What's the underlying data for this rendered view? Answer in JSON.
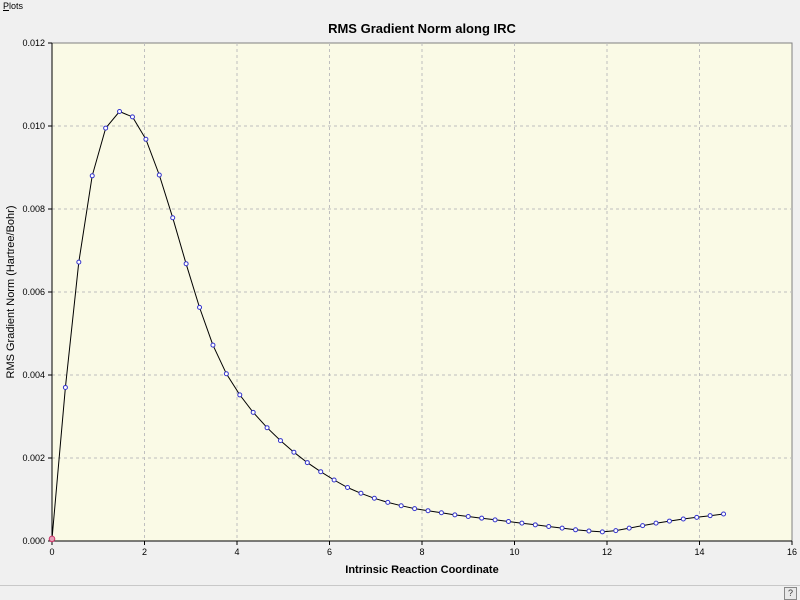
{
  "menu": {
    "plots_underlined": "P",
    "plots_rest": "lots"
  },
  "status": {
    "help_glyph": "?"
  },
  "chart_data": {
    "type": "line",
    "title": "RMS Gradient Norm along IRC",
    "xlabel": "Intrinsic Reaction Coordinate",
    "ylabel": "RMS Gradient Norm (Hartree/Bohr)",
    "xlim": [
      0,
      16
    ],
    "ylim": [
      0,
      0.012
    ],
    "xticks": [
      0,
      2,
      4,
      6,
      8,
      10,
      12,
      14,
      16
    ],
    "xtick_labels": [
      "0",
      "2",
      "4",
      "6",
      "8",
      "10",
      "12",
      "14",
      "16"
    ],
    "yticks": [
      0,
      0.002,
      0.004,
      0.006,
      0.008,
      0.01,
      0.012
    ],
    "ytick_labels": [
      "0.000",
      "0.002",
      "0.004",
      "0.006",
      "0.008",
      "0.010",
      "0.012"
    ],
    "grid": true,
    "colors": {
      "plot_bg": "#fafae6",
      "line": "#000000",
      "marker": "#3333cc",
      "first_marker": "#cc3366",
      "grid": "#bfbfbf"
    },
    "series": [
      {
        "x": [
          0.0,
          0.29,
          0.58,
          0.87,
          1.16,
          1.46,
          1.74,
          2.03,
          2.32,
          2.61,
          2.9,
          3.19,
          3.48,
          3.77,
          4.06,
          4.35,
          4.65,
          4.94,
          5.23,
          5.52,
          5.81,
          6.1,
          6.39,
          6.68,
          6.97,
          7.26,
          7.55,
          7.84,
          8.13,
          8.42,
          8.71,
          9.0,
          9.29,
          9.58,
          9.87,
          10.16,
          10.45,
          10.74,
          11.03,
          11.32,
          11.61,
          11.9,
          12.19,
          12.48,
          12.77,
          13.06,
          13.35,
          13.65,
          13.94,
          14.23,
          14.52
        ],
        "y": [
          5e-05,
          0.0037,
          0.00672,
          0.0088,
          0.00995,
          0.01035,
          0.01022,
          0.00968,
          0.00882,
          0.00779,
          0.00668,
          0.00563,
          0.00472,
          0.00403,
          0.00352,
          0.0031,
          0.00273,
          0.00242,
          0.00214,
          0.00189,
          0.00167,
          0.00147,
          0.00129,
          0.00115,
          0.00103,
          0.00093,
          0.00085,
          0.00078,
          0.00073,
          0.00068,
          0.00063,
          0.00059,
          0.00055,
          0.00051,
          0.00047,
          0.00043,
          0.00039,
          0.00035,
          0.00031,
          0.00027,
          0.00024,
          0.00022,
          0.00025,
          0.00031,
          0.00037,
          0.00043,
          0.00048,
          0.00053,
          0.00057,
          0.00061,
          0.00065
        ]
      }
    ]
  }
}
